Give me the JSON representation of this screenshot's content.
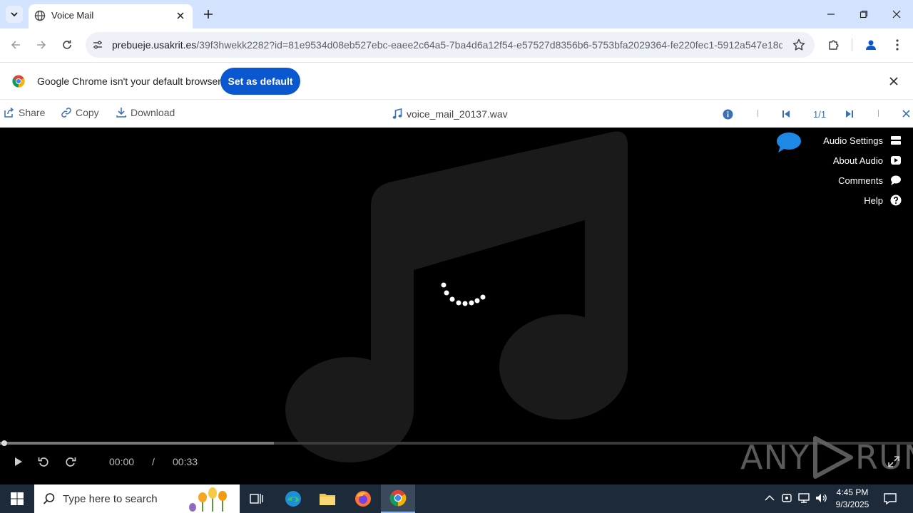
{
  "browser": {
    "tab_title": "Voice Mail",
    "url_host": "prebueje.usakrit.es",
    "url_path": "/39f3hwekk2282?id=81e9534d08eb527ebc-eaee2c64a5-7ba4d6a12f54-e57527d8356b6-5753bfa2029364-fe220fec1-5912a547e18d..."
  },
  "infobar": {
    "message": "Google Chrome isn't your default browser",
    "button_label": "Set as default"
  },
  "viewer": {
    "share_label": "Share",
    "copy_label": "Copy",
    "download_label": "Download",
    "file_name": "voice_mail_20137.wav",
    "page_count": "1/1"
  },
  "side_menu": {
    "audio_settings": "Audio Settings",
    "about_audio": "About Audio",
    "comments": "Comments",
    "help": "Help"
  },
  "player": {
    "current_time": "00:00",
    "separator": "/",
    "duration": "00:33",
    "buffered_fraction": 0.3
  },
  "watermark": {
    "left": "ANY",
    "right": "RUN"
  },
  "taskbar": {
    "search_placeholder": "Type here to search",
    "time": "4:45 PM",
    "date": "9/3/2025"
  },
  "colors": {
    "chrome_accent": "#0b57d0",
    "tabstrip": "#d3e3fd",
    "viewer_blue": "#3b6fb6",
    "taskbar": "#1c2a3a"
  }
}
